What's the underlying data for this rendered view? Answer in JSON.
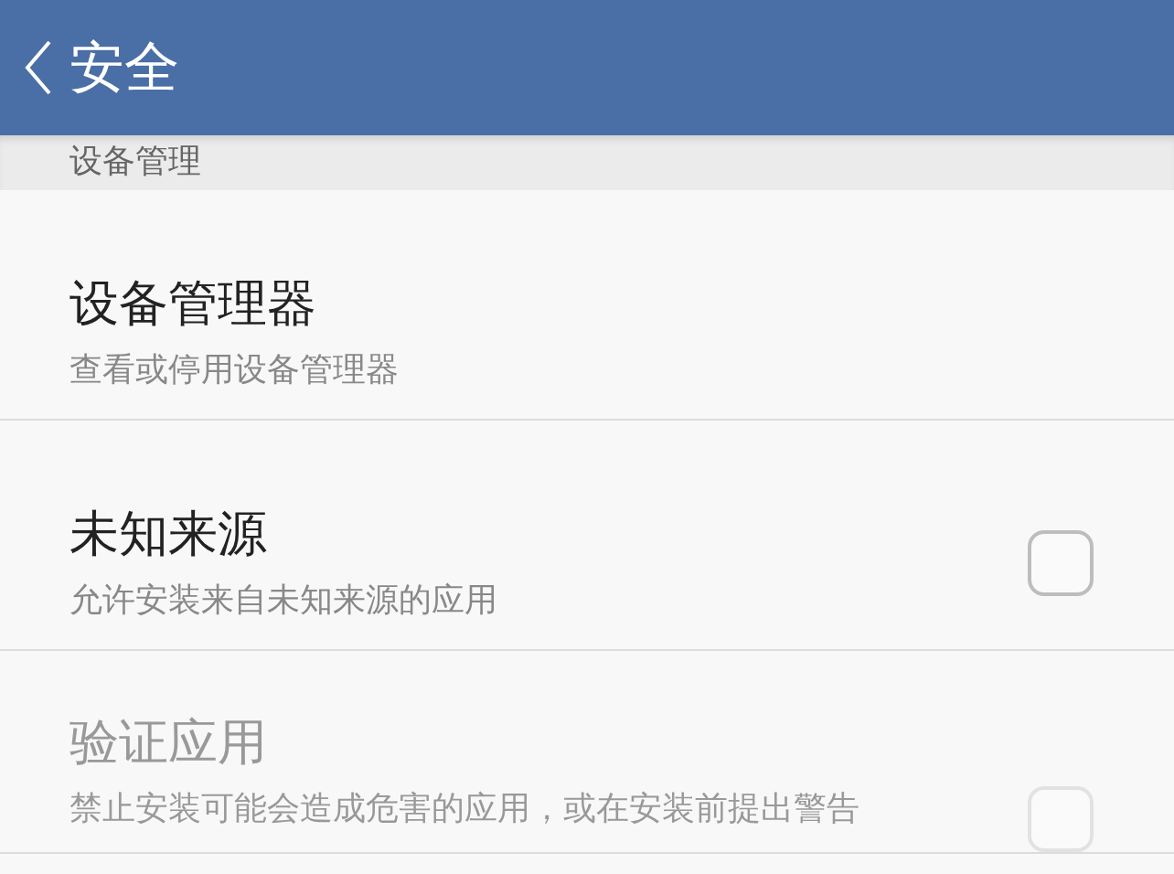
{
  "header": {
    "back_button": true,
    "title": "安全"
  },
  "section": {
    "title": "设备管理"
  },
  "items": [
    {
      "kind": "link",
      "title": "设备管理器",
      "subtitle": "查看或停用设备管理器",
      "disabled": false
    },
    {
      "kind": "checkbox",
      "title": "未知来源",
      "subtitle": "允许安装来自未知来源的应用",
      "disabled": false,
      "checked": false
    },
    {
      "kind": "checkbox",
      "title": "验证应用",
      "subtitle": "禁止安装可能会造成危害的应用，或在安装前提出警告",
      "disabled": true,
      "checked": false
    }
  ]
}
